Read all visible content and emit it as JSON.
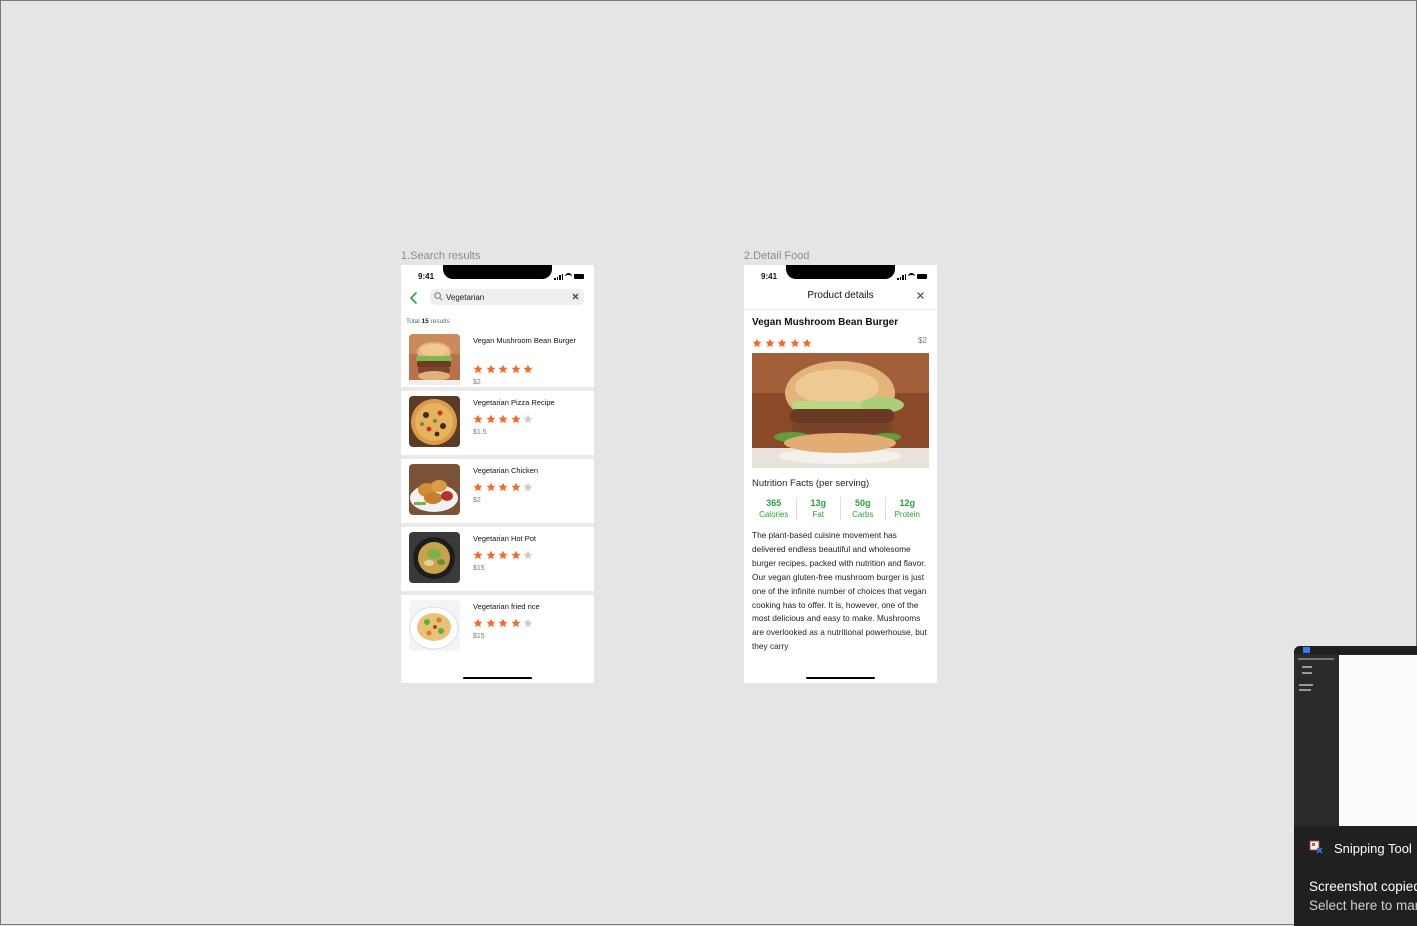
{
  "frames": {
    "search_label": "1.Search results",
    "detail_label": "2.Detail Food"
  },
  "status": {
    "time": "9:41"
  },
  "search": {
    "query": "Vegetarian",
    "total_prefix": "Total",
    "total_count": "15",
    "total_suffix": "results",
    "items": [
      {
        "name": "Vegan Mushroom Bean Burger",
        "rating": 5,
        "price": "$2"
      },
      {
        "name": "Vegetarian Pizza Recipe",
        "rating": 4,
        "price": "$1.5"
      },
      {
        "name": "Vegetarian Chicken",
        "rating": 4,
        "price": "$2"
      },
      {
        "name": "Vegetarian Hot Pot",
        "rating": 4,
        "price": "$15"
      },
      {
        "name": "Vegetarian fried rice",
        "rating": 4,
        "price": "$15"
      }
    ]
  },
  "detail": {
    "header_title": "Product details",
    "name": "Vegan Mushroom Bean Burger",
    "rating": 5,
    "price": "$2",
    "nutrition_title": "Nutrition Facts (per serving)",
    "nutrition": [
      {
        "value": "365",
        "label": "Calories"
      },
      {
        "value": "13g",
        "label": "Fat"
      },
      {
        "value": "50g",
        "label": "Carbs"
      },
      {
        "value": "12g",
        "label": "Protein"
      }
    ],
    "description": "The plant-based cuisine movement has delivered endless beautiful and wholesome burger recipes, packed with nutrition and flavor. Our vegan gluten-free mushroom burger is just one of the infinite number of choices that vegan cooking has to offer. It is, however, one of the most delicious and easy to make. Mushrooms are overlooked as a nutritional powerhouse, but they carry"
  },
  "snipping_tool": {
    "app_name": "Snipping Tool",
    "message": "Screenshot copied to clipboard",
    "sub": "Select here to mark up and share"
  },
  "colors": {
    "star_active": "#f26b2c",
    "star_inactive": "#cccccc",
    "nutrition_green": "#2e9e3c",
    "back_arrow": "#2e9e3c"
  }
}
